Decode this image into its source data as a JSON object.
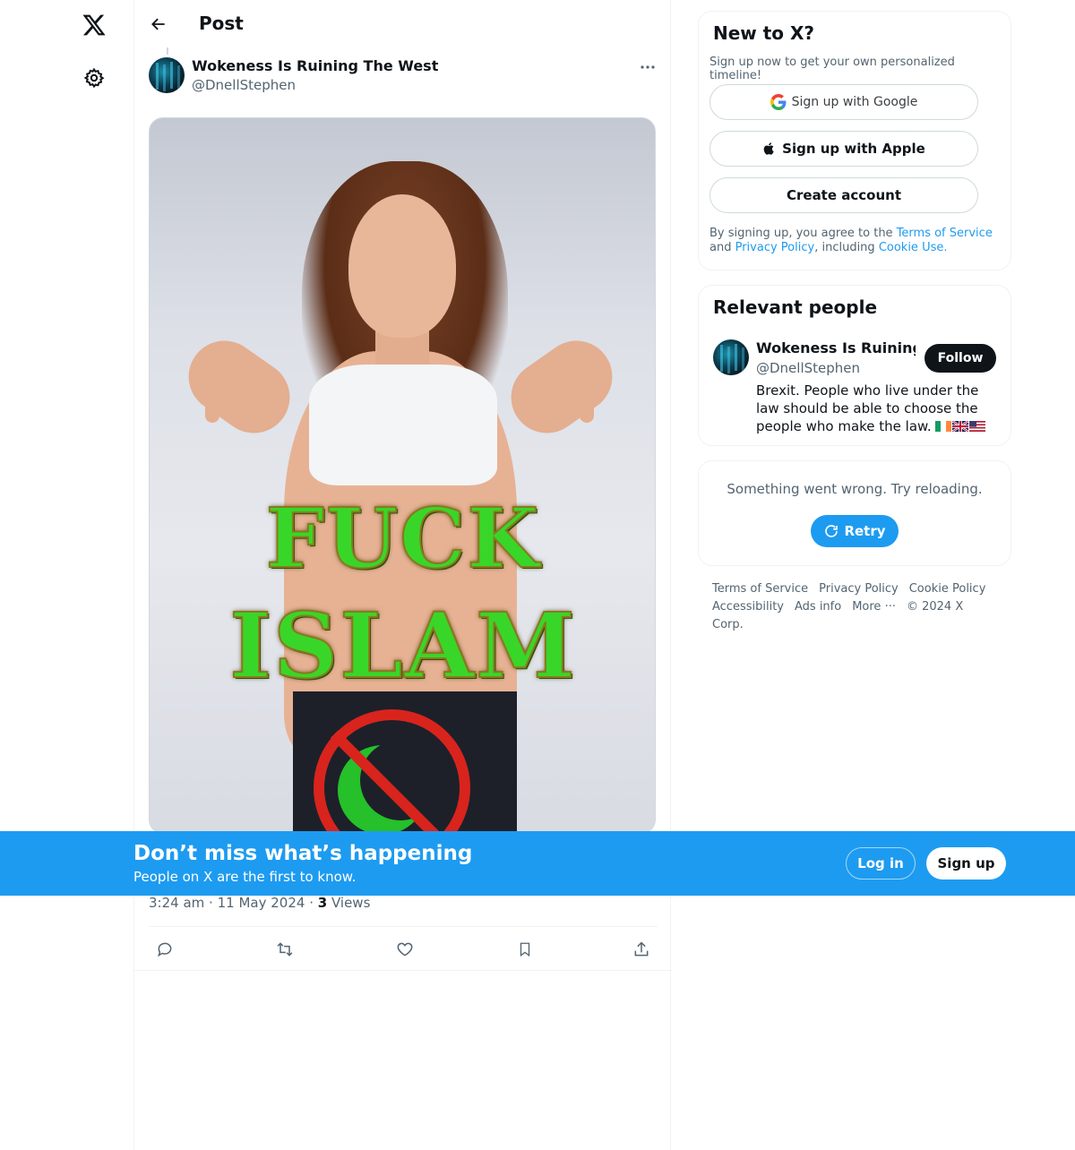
{
  "header": {
    "title": "Post"
  },
  "post": {
    "author_name": "Wokeness Is Ruining The West",
    "author_handle": "@DnellStephen",
    "image_text_line1": "FUCK",
    "image_text_line2": "ISLAM",
    "time": "3:24 am",
    "date": "11 May 2024",
    "views_count": "3",
    "views_label": "Views",
    "separator": "·"
  },
  "signup_card": {
    "title": "New to X?",
    "subtitle": "Sign up now to get your own personalized timeline!",
    "google_label": "Sign up with Google",
    "apple_label": "Sign up with Apple",
    "create_label": "Create account",
    "legal_prefix": "By signing up, you agree to the ",
    "terms_link": "Terms of Service",
    "legal_and": " and ",
    "privacy_link": "Privacy Policy",
    "legal_including": ", including ",
    "cookie_link": "Cookie Use."
  },
  "relevant_people": {
    "title": "Relevant people",
    "name": "Wokeness Is Ruining The West",
    "handle": "@DnellStephen",
    "follow_label": "Follow",
    "bio": "Brexit. People who live under the law should be able to choose the people who make the law."
  },
  "error_card": {
    "message": "Something went wrong. Try reloading.",
    "retry_label": "Retry"
  },
  "footer": {
    "terms": "Terms of Service",
    "privacy": "Privacy Policy",
    "cookie": "Cookie Policy",
    "accessibility": "Accessibility",
    "ads": "Ads info",
    "more": "More ···",
    "copyright": "© 2024 X Corp."
  },
  "banner": {
    "title": "Don’t miss what’s happening",
    "subtitle": "People on X are the first to know.",
    "login_label": "Log in",
    "signup_label": "Sign up"
  },
  "colors": {
    "accent": "#1d9bf0",
    "text": "#0f1419",
    "secondary": "#536471"
  },
  "icons": [
    "x-logo-icon",
    "gear-icon",
    "back-arrow-icon",
    "more-icon",
    "reply-icon",
    "repost-icon",
    "like-icon",
    "bookmark-icon",
    "share-icon",
    "google-icon",
    "apple-icon",
    "retry-icon",
    "ireland-flag-icon",
    "uk-flag-icon",
    "us-flag-icon"
  ]
}
